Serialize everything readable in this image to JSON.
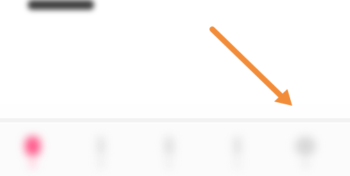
{
  "header": {
    "title_placeholder": ""
  },
  "tabbar": {
    "tabs": [
      {
        "icon": "home-icon",
        "label": "",
        "active": true,
        "color": "#ff5a8c"
      },
      {
        "icon": "tab-icon",
        "label": "",
        "active": false,
        "color": "#e4e4e4"
      },
      {
        "icon": "tab-icon",
        "label": "",
        "active": false,
        "color": "#e2e2e2"
      },
      {
        "icon": "tab-icon",
        "label": "",
        "active": false,
        "color": "#e4e4e4"
      },
      {
        "icon": "profile-icon",
        "label": "",
        "active": false,
        "color": "#d9d9d9"
      }
    ]
  },
  "annotation": {
    "type": "arrow",
    "color": "#f28c38",
    "points_to": "profile-tab"
  }
}
